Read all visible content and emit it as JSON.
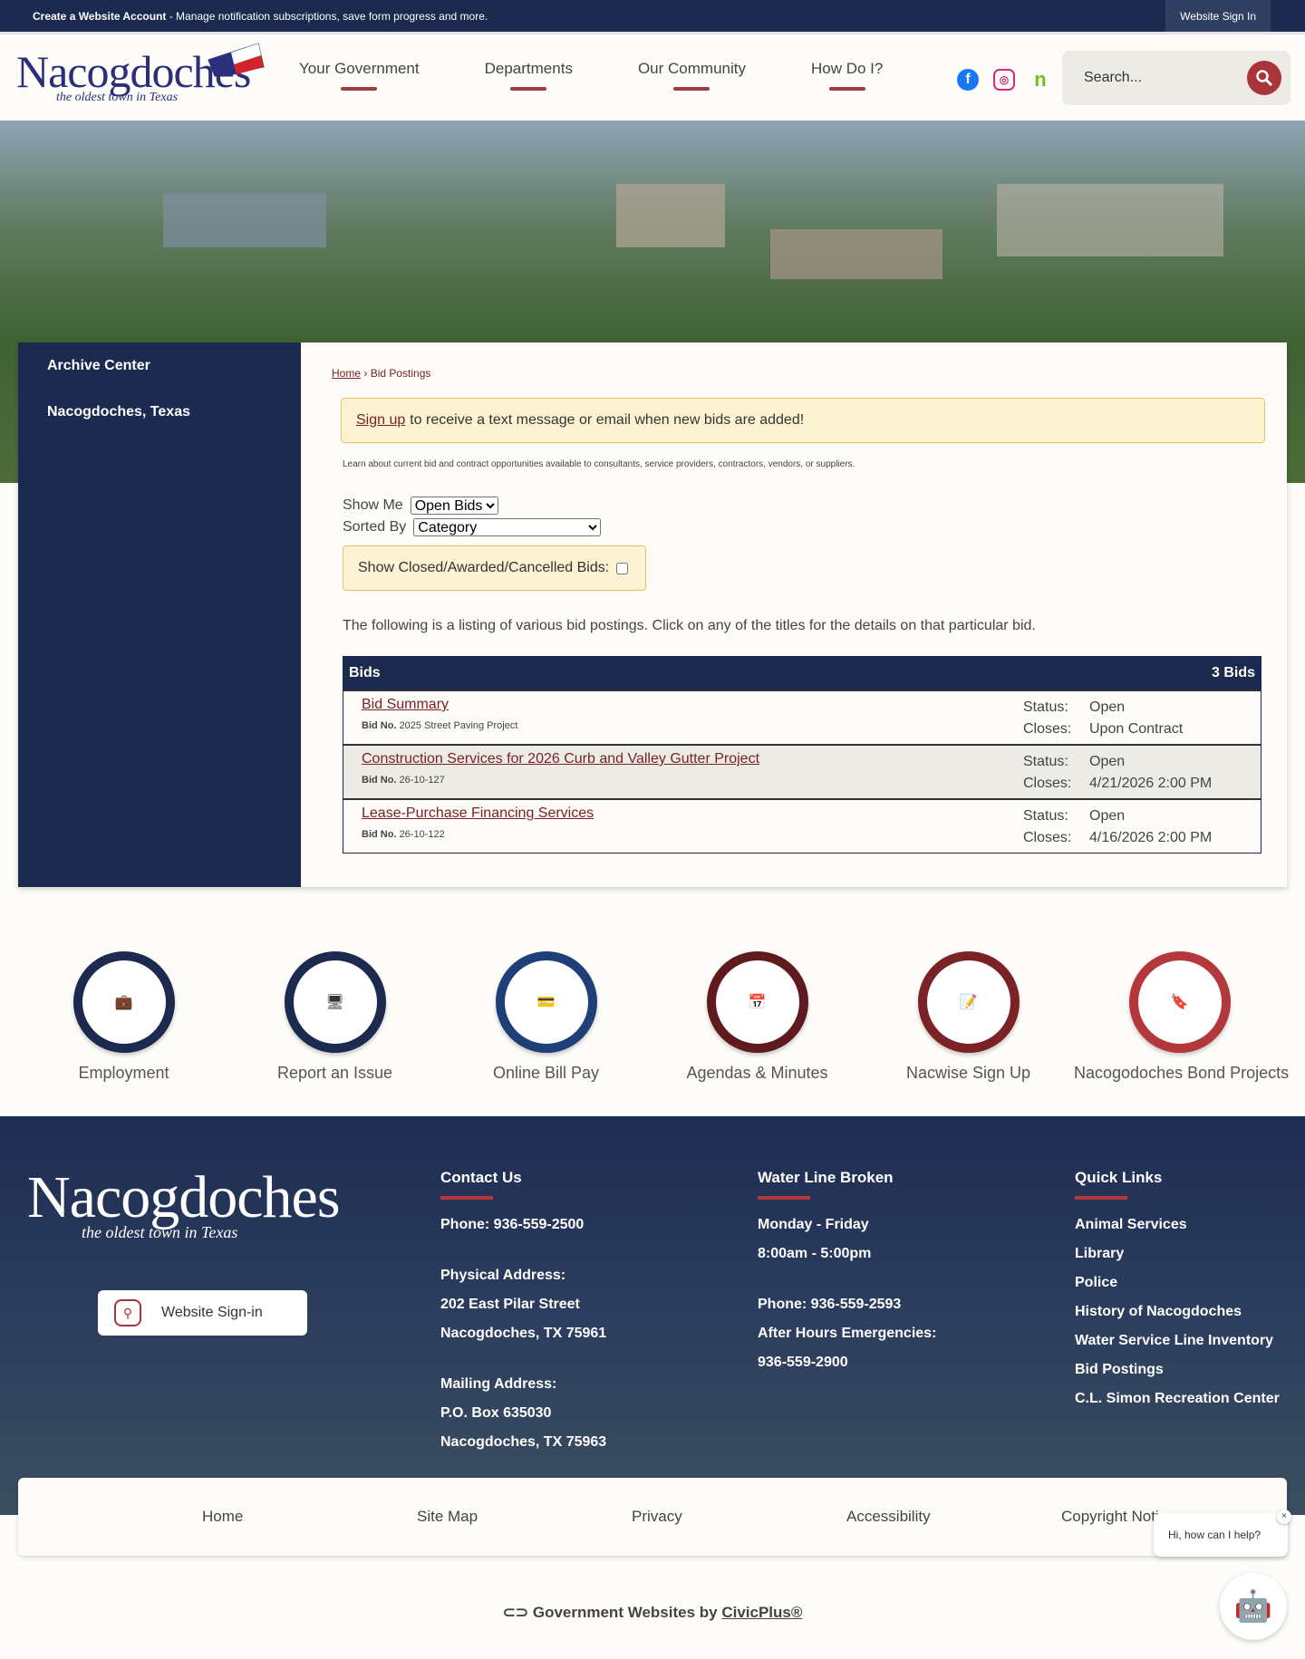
{
  "topbar": {
    "create_label": "Create a Website Account",
    "create_desc": " - Manage notification subscriptions, save form progress and more.",
    "signin": "Website Sign In"
  },
  "logo": {
    "name": "Nacogdoches",
    "tagline": "the oldest town in Texas"
  },
  "nav": [
    "Your Government",
    "Departments",
    "Our Community",
    "How Do I?"
  ],
  "social": [
    "facebook-icon",
    "instagram-icon",
    "nextdoor-icon"
  ],
  "search": {
    "placeholder": "Search..."
  },
  "sidebar": [
    "Archive Center",
    "Nacogdoches, Texas"
  ],
  "breadcrumb": {
    "home": "Home",
    "sep": " › ",
    "current": "Bid Postings"
  },
  "alert": {
    "link": "Sign up",
    "text": "to receive a text message or email when new bids are added!"
  },
  "intro": "Learn about current bid and contract opportunities available to consultants, service providers, contractors, vendors, or suppliers.",
  "filters": {
    "show_me_label": "Show Me",
    "show_me_value": "Open Bids",
    "sorted_by_label": "Sorted By",
    "sorted_by_value": "Category",
    "closed_label": "Show Closed/Awarded/Cancelled Bids:"
  },
  "listing_text": "The following is a listing of various bid postings. Click on any of the titles for the details on that particular bid.",
  "bids": {
    "header": "Bids",
    "count": "3 Bids",
    "bid_no_label": "Bid No.",
    "status_label": "Status:",
    "closes_label": "Closes:",
    "items": [
      {
        "title": "Bid Summary",
        "no": "2025 Street Paving Project",
        "status": "Open",
        "closes": "Upon Contract"
      },
      {
        "title": "Construction Services for 2026 Curb and Valley Gutter Project",
        "no": "26-10-127",
        "status": "Open",
        "closes": "4/21/2026 2:00 PM"
      },
      {
        "title": "Lease-Purchase Financing Services",
        "no": "26-10-122",
        "status": "Open",
        "closes": "4/16/2026 2:00 PM"
      }
    ]
  },
  "quick_links": [
    {
      "label": "Employment",
      "icon": "briefcase-icon",
      "color": "#1b2a4e"
    },
    {
      "label": "Report an Issue",
      "icon": "devices-icon",
      "color": "#1b2a4e"
    },
    {
      "label": "Online Bill Pay",
      "icon": "credit-card-icon",
      "color": "#1f3f78"
    },
    {
      "label": "Agendas & Minutes",
      "icon": "calendar-edit-icon",
      "color": "#5e1a1d"
    },
    {
      "label": "Nacwise Sign Up",
      "icon": "notepad-icon",
      "color": "#7a2225"
    },
    {
      "label": "Nacogodoches Bond Projects",
      "icon": "bookmark-book-icon",
      "color": "#b4373c"
    }
  ],
  "footer": {
    "signin": "Website Sign-in",
    "contact": {
      "title": "Contact Us",
      "lines": [
        "Phone: 936-559-2500",
        "",
        "Physical Address:",
        "202 East Pilar Street",
        "Nacogdoches, TX 75961",
        "",
        "Mailing Address:",
        "P.O. Box 635030",
        "Nacogdoches, TX 75963"
      ]
    },
    "water": {
      "title": "Water Line Broken",
      "lines": [
        "Monday - Friday",
        "8:00am - 5:00pm",
        "",
        "Phone: 936-559-2593",
        "After Hours Emergencies:",
        "936-559-2900"
      ]
    },
    "quick": {
      "title": "Quick Links",
      "lines": [
        "Animal Services",
        "Library",
        "Police",
        "History of Nacogdoches",
        "Water Service Line Inventory",
        "Bid Postings",
        "C.L. Simon Recreation Center"
      ]
    },
    "links": [
      "Home",
      "Site Map",
      "Privacy",
      "Accessibility",
      "Copyright Notices"
    ],
    "chat": "Hi, how can I help?",
    "chat_close": "×",
    "civic_prefix": "Government Websites by ",
    "civic_link": "CivicPlus®"
  }
}
